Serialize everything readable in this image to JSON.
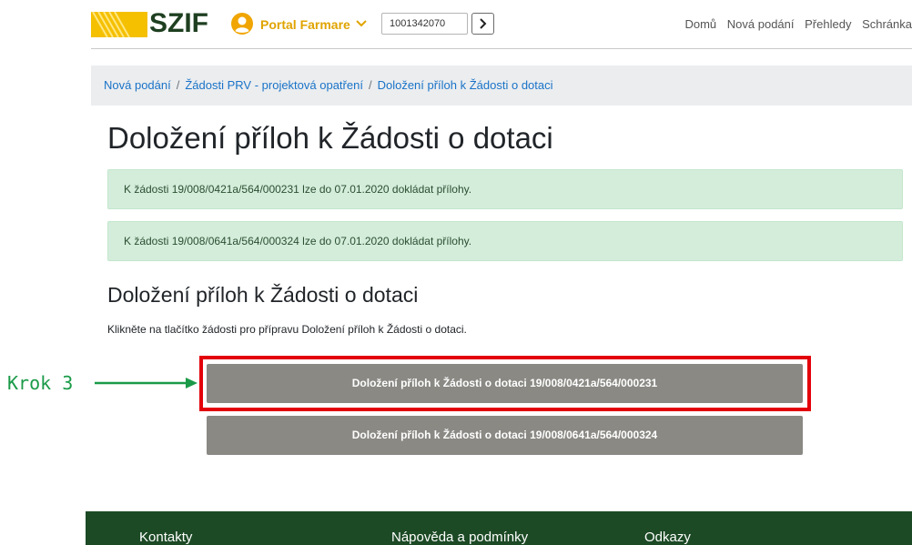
{
  "header": {
    "logo_text": "SZIF",
    "portal_label": "Portal Farmare",
    "client_id_value": "1001342070",
    "nav": [
      "Domů",
      "Nová podání",
      "Přehledy",
      "Schránka"
    ]
  },
  "breadcrumb": {
    "items": [
      "Nová podání",
      "Žádosti PRV - projektová opatření",
      "Doložení příloh k Žádosti o dotaci"
    ],
    "separator": "/"
  },
  "page_title": "Doložení příloh k Žádosti o dotaci",
  "alerts": [
    "K žádosti 19/008/0421a/564/000231 lze do 07.01.2020 dokládat přílohy.",
    "K žádosti 19/008/0641a/564/000324 lze do 07.01.2020 dokládat přílohy."
  ],
  "section": {
    "title": "Doložení příloh k Žádosti o dotaci",
    "instruction": "Klikněte na tlačítko žádosti pro přípravu Doložení příloh k Žádosti o dotaci.",
    "buttons": [
      "Doložení příloh k Žádosti o dotaci 19/008/0421a/564/000231",
      "Doložení příloh k Žádosti o dotaci 19/008/0641a/564/000324"
    ]
  },
  "annotation": {
    "label": "Krok 3"
  },
  "footer": {
    "columns": [
      "Kontakty",
      "Nápověda a podmínky",
      "Odkazy"
    ]
  },
  "colors": {
    "brand_green": "#1c4a25",
    "accent_yellow": "#f5c000",
    "button_grey": "#8a8984",
    "alert_bg": "#d4eddb",
    "highlight_red": "#e3000b",
    "annotation_green": "#1a9a48"
  }
}
